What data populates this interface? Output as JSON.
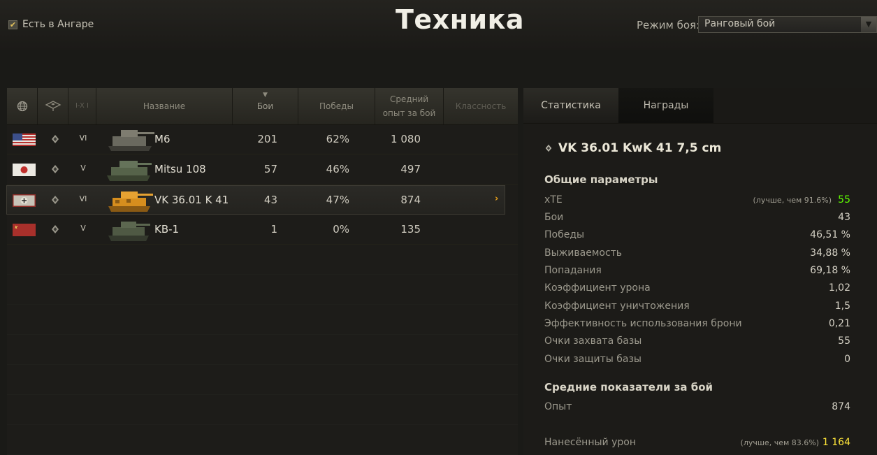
{
  "header": {
    "title": "Техника",
    "hangar_checkbox_label": "Есть в Ангаре",
    "hangar_checked": true,
    "mode_label": "Режим боя:",
    "mode_value": "Ранговый бой"
  },
  "table": {
    "columns": {
      "nation": "",
      "type": "",
      "tier": "I-X I",
      "name": "Название",
      "battles": "Бои",
      "wins": "Победы",
      "avg_exp": "Средний опыт за бой",
      "class": "Классность"
    },
    "sorted_by": "battles",
    "rows": [
      {
        "flag": "usa-flag-icon",
        "tier": "VI",
        "name": "M6",
        "battles": "201",
        "wins": "62%",
        "avg_exp": "1 080",
        "selected": false
      },
      {
        "flag": "japan-flag-icon",
        "tier": "V",
        "name": "Mitsu 108",
        "battles": "57",
        "wins": "46%",
        "avg_exp": "497",
        "selected": false
      },
      {
        "flag": "germany-flag-icon",
        "tier": "VI",
        "name": "VK 36.01 K 41",
        "battles": "43",
        "wins": "47%",
        "avg_exp": "874",
        "selected": true
      },
      {
        "flag": "ussr-flag-icon",
        "tier": "V",
        "name": "KB-1",
        "battles": "1",
        "wins": "0%",
        "avg_exp": "135",
        "selected": false
      }
    ]
  },
  "details": {
    "tabs": [
      {
        "label": "Статистика",
        "active": true
      },
      {
        "label": "Награды",
        "active": false
      }
    ],
    "vehicle_title": "VK 36.01 KwK 41 7,5 cm",
    "general_title": "Общие параметры",
    "general": {
      "xte": {
        "label": "xTE",
        "note": "(лучше, чем 91.6%)",
        "value": "55"
      },
      "battles": {
        "label": "Бои",
        "value": "43"
      },
      "wins": {
        "label": "Победы",
        "value": "46,51 %"
      },
      "survival": {
        "label": "Выживаемость",
        "value": "34,88 %"
      },
      "hits": {
        "label": "Попадания",
        "value": "69,18 %"
      },
      "damage_ratio": {
        "label": "Коэффициент урона",
        "value": "1,02"
      },
      "kill_ratio": {
        "label": "Коэффициент уничтожения",
        "value": "1,5"
      },
      "armor_eff": {
        "label": "Эффективность использования брони",
        "value": "0,21"
      },
      "capture": {
        "label": "Очки захвата базы",
        "value": "55"
      },
      "defense": {
        "label": "Очки защиты базы",
        "value": "0"
      }
    },
    "avg_title": "Средние показатели за бой",
    "avg": {
      "exp": {
        "label": "Опыт",
        "value": "874"
      },
      "damage": {
        "label": "Нанесённый урон",
        "note": "(лучше, чем 83.6%)",
        "value": "1 164"
      }
    },
    "colors": {
      "good": "#60ff00",
      "very_good": "#fee539",
      "accent": "#e8a01a"
    }
  }
}
